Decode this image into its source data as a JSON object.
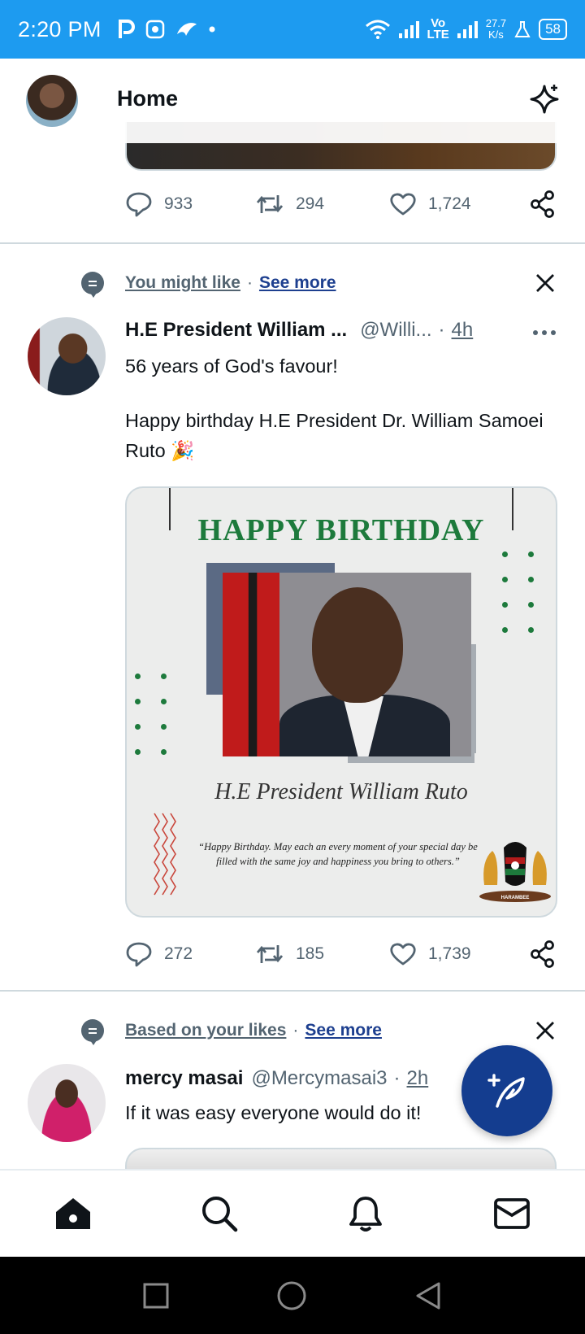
{
  "status_bar": {
    "time": "2:20 PM",
    "network_type_line1": "Vo",
    "network_type_line2": "LTE",
    "speed_value": "27.7",
    "speed_unit": "K/s",
    "battery": "58"
  },
  "header": {
    "title": "Home"
  },
  "tweets": [
    {
      "actions": {
        "replies": "933",
        "retweets": "294",
        "likes": "1,724"
      }
    },
    {
      "context_label": "You might like",
      "context_sep": "·",
      "see_more": "See more",
      "name": "H.E President William ...",
      "handle": "@Willi...",
      "dot": "·",
      "time": "4h",
      "text_line1": "56 years of God's favour!",
      "text_line2": "Happy birthday H.E President Dr. William Samoei Ruto 🎉",
      "card": {
        "heading": "HAPPY BIRTHDAY",
        "script_name": "H.E President William Ruto",
        "quote": "“Happy Birthday. May each an every moment of your special day be filled with the same joy and happiness you bring to others.”",
        "emblem_text": "HARAMBEE"
      },
      "actions": {
        "replies": "272",
        "retweets": "185",
        "likes": "1,739"
      }
    },
    {
      "context_label": "Based on your likes",
      "context_sep": "·",
      "see_more": "See more",
      "name": "mercy masai",
      "handle": "@Mercymasai3",
      "dot": "·",
      "time": "2h",
      "text": "If it was easy everyone would do it!"
    }
  ],
  "icons": {
    "reply": "comment-icon",
    "retweet": "retweet-icon",
    "like": "heart-icon",
    "share": "share-icon",
    "fab": "compose-icon",
    "nav": [
      "home-icon",
      "search-icon",
      "bell-icon",
      "mail-icon"
    ]
  },
  "colors": {
    "status_bar": "#1d9bf0",
    "accent_link": "#1d3f8f",
    "fab": "#143d8f",
    "card_green": "#1d7a3c",
    "muted": "#536471"
  }
}
